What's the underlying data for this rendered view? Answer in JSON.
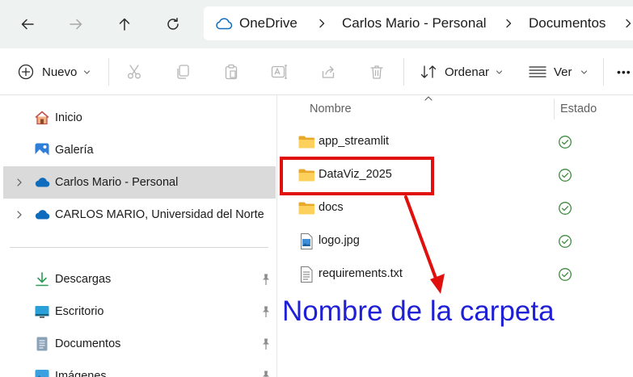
{
  "breadcrumb": {
    "root": "OneDrive",
    "items": [
      "Carlos Mario - Personal",
      "Documentos"
    ]
  },
  "toolbar": {
    "new_label": "Nuevo",
    "sort_label": "Ordenar",
    "view_label": "Ver",
    "more_label": "•••"
  },
  "sidebar": {
    "top": [
      {
        "label": "Inicio",
        "icon": "home-icon"
      },
      {
        "label": "Galería",
        "icon": "gallery-icon"
      }
    ],
    "cloud": [
      {
        "label": "Carlos Mario - Personal",
        "icon": "onedrive-cloud-icon",
        "selected": true
      },
      {
        "label": "CARLOS MARIO, Universidad del Norte",
        "icon": "onedrive-cloud-icon",
        "selected": false
      }
    ],
    "quick": [
      {
        "label": "Descargas",
        "icon": "download-icon"
      },
      {
        "label": "Escritorio",
        "icon": "desktop-icon"
      },
      {
        "label": "Documentos",
        "icon": "document-icon"
      },
      {
        "label": "Imágenes",
        "icon": "pictures-icon"
      }
    ]
  },
  "file_list": {
    "columns": {
      "name": "Nombre",
      "status": "Estado"
    },
    "rows": [
      {
        "name": "app_streamlit",
        "type": "folder",
        "status": "synced-check-icon"
      },
      {
        "name": "DataViz_2025",
        "type": "folder",
        "status": "synced-check-icon"
      },
      {
        "name": "docs",
        "type": "folder",
        "status": "synced-check-icon"
      },
      {
        "name": "logo.jpg",
        "type": "image",
        "status": "synced-check-icon"
      },
      {
        "name": "requirements.txt",
        "type": "text",
        "status": "synced-check-icon"
      }
    ]
  },
  "annotation": {
    "label": "Nombre de la carpeta",
    "box_color": "#e0100f",
    "text_color": "#1f1fd8"
  },
  "colors": {
    "accent_blue": "#0f6cbd",
    "folder_yellow": "#f8c93b",
    "sync_green": "#3f8a3f",
    "selected_bg": "#dadada"
  }
}
